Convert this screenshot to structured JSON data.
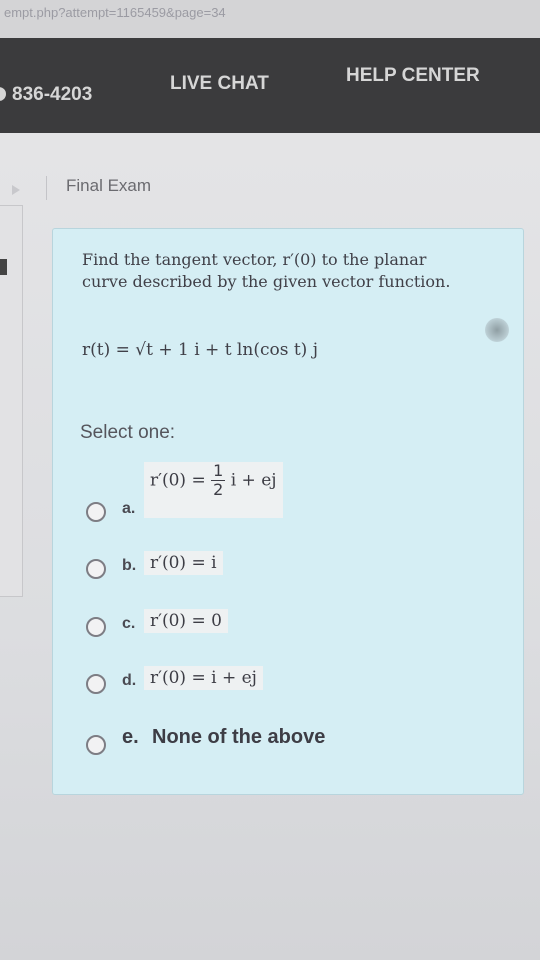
{
  "browser": {
    "url": "empt.php?attempt=1165459&page=34"
  },
  "nav": {
    "phone": "836-4203",
    "live_chat": "LIVE CHAT",
    "help_center": "HELP CENTER"
  },
  "breadcrumb": {
    "current": "Final Exam"
  },
  "question": {
    "text": "Find the tangent vector, r′(0) to the planar curve described by the given vector function.",
    "formula": "r(t) = √t + 1 i + t ln(cos t) j",
    "prompt": "Select one:"
  },
  "options": [
    {
      "letter": "a.",
      "lhs": "r′(0) =",
      "frac_num": "1",
      "frac_den": "2",
      "rhs": "i + ej"
    },
    {
      "letter": "b.",
      "text": "r′(0) = i"
    },
    {
      "letter": "c.",
      "text": "r′(0) = 0"
    },
    {
      "letter": "d.",
      "text": "r′(0) = i + ej"
    },
    {
      "letter": "e.",
      "text": "None of the above"
    }
  ]
}
